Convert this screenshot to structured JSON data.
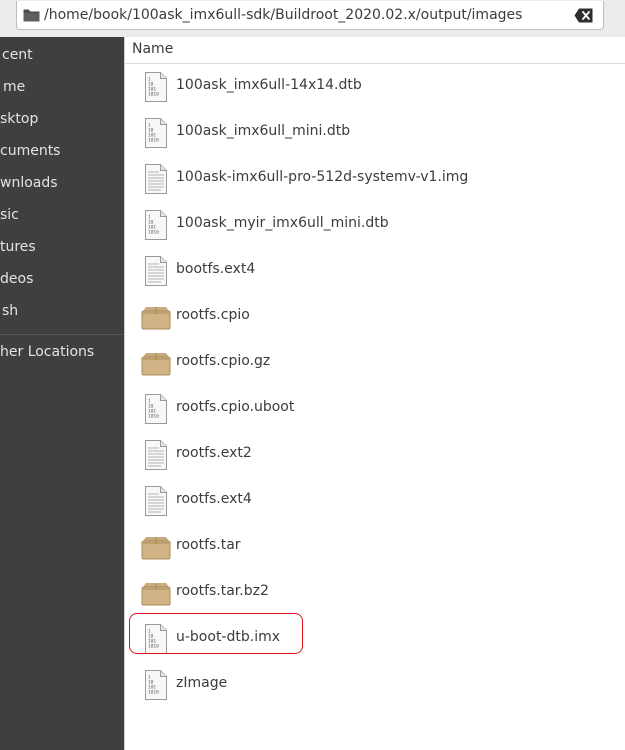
{
  "location": {
    "path": "/home/book/100ask_imx6ull-sdk/Buildroot_2020.02.x/output/images"
  },
  "sidebar": {
    "items": [
      {
        "label": "cent",
        "name": "sidebar-item-recent"
      },
      {
        "label": "me",
        "name": "sidebar-item-home"
      },
      {
        "label": "sktop",
        "name": "sidebar-item-desktop"
      },
      {
        "label": "cuments",
        "name": "sidebar-item-documents"
      },
      {
        "label": "wnloads",
        "name": "sidebar-item-downloads"
      },
      {
        "label": "sic",
        "name": "sidebar-item-music"
      },
      {
        "label": "tures",
        "name": "sidebar-item-pictures"
      },
      {
        "label": "deos",
        "name": "sidebar-item-videos"
      },
      {
        "label": "sh",
        "name": "sidebar-item-trash"
      }
    ],
    "other": "her Locations"
  },
  "list": {
    "column_name": "Name",
    "files": [
      {
        "name": "100ask_imx6ull-14x14.dtb",
        "icon": "binary-file-icon"
      },
      {
        "name": "100ask_imx6ull_mini.dtb",
        "icon": "binary-file-icon"
      },
      {
        "name": "100ask-imx6ull-pro-512d-systemv-v1.img",
        "icon": "text-file-icon"
      },
      {
        "name": "100ask_myir_imx6ull_mini.dtb",
        "icon": "binary-file-icon"
      },
      {
        "name": "bootfs.ext4",
        "icon": "text-file-icon"
      },
      {
        "name": "rootfs.cpio",
        "icon": "archive-icon"
      },
      {
        "name": "rootfs.cpio.gz",
        "icon": "archive-icon"
      },
      {
        "name": "rootfs.cpio.uboot",
        "icon": "binary-file-icon"
      },
      {
        "name": "rootfs.ext2",
        "icon": "text-file-icon"
      },
      {
        "name": "rootfs.ext4",
        "icon": "text-file-icon"
      },
      {
        "name": "rootfs.tar",
        "icon": "archive-icon"
      },
      {
        "name": "rootfs.tar.bz2",
        "icon": "archive-icon"
      },
      {
        "name": "u-boot-dtb.imx",
        "icon": "binary-file-icon"
      },
      {
        "name": "zImage",
        "icon": "binary-file-icon"
      }
    ]
  },
  "annotation": {
    "highlighted_file": "u-boot-dtb.imx",
    "color": "#e0101a"
  }
}
